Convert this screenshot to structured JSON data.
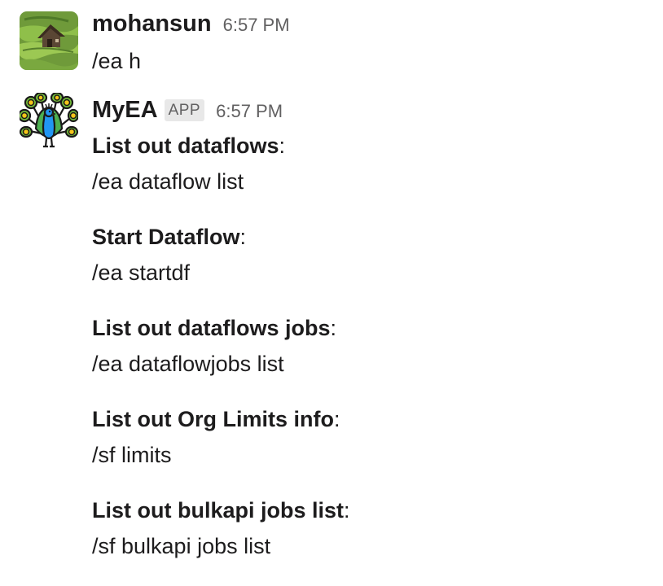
{
  "messages": [
    {
      "sender": "mohansun",
      "time": "6:57 PM",
      "text": "/ea h",
      "avatar_icon": "landscape-photo"
    },
    {
      "sender": "MyEA",
      "badge": "APP",
      "time": "6:57 PM",
      "avatar_icon": "peacock-icon",
      "commands": [
        {
          "title": "List out dataflows",
          "colon": ":",
          "command": "/ea dataflow list"
        },
        {
          "title": "Start Dataflow",
          "colon": ":",
          "command": "/ea startdf"
        },
        {
          "title": "List out dataflows jobs",
          "colon": ":",
          "command": "/ea dataflowjobs list"
        },
        {
          "title": "List out Org Limits info",
          "colon": ":",
          "command": "/sf limits"
        },
        {
          "title": "List out bulkapi jobs list",
          "colon": ":",
          "command": "/sf bulkapi jobs list"
        }
      ]
    }
  ]
}
